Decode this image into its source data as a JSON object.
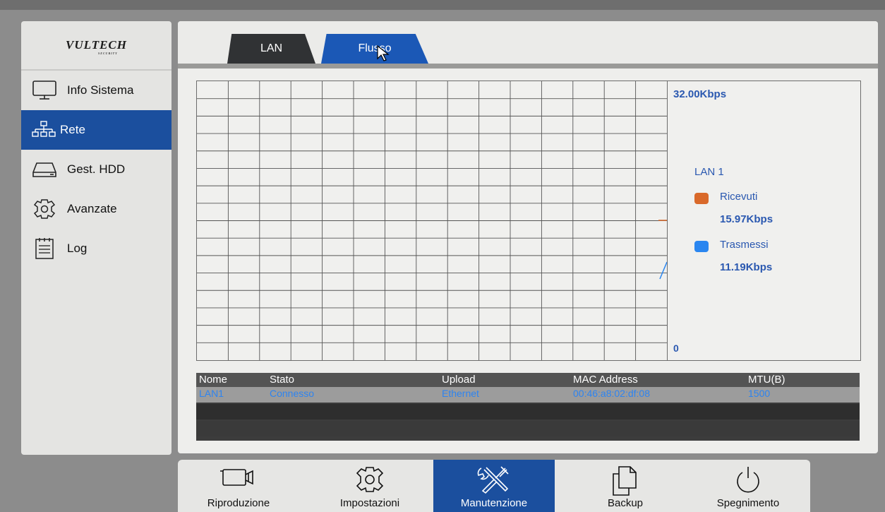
{
  "brand": {
    "logo_text": "VULTECH",
    "logo_sub": "SECURITY"
  },
  "sidebar": {
    "items": [
      {
        "label": "Info Sistema",
        "icon": "monitor-icon",
        "active": false
      },
      {
        "label": "Rete",
        "icon": "network-icon",
        "active": true
      },
      {
        "label": "Gest. HDD",
        "icon": "hdd-icon",
        "active": false
      },
      {
        "label": "Avanzate",
        "icon": "gear-icon",
        "active": false
      },
      {
        "label": "Log",
        "icon": "log-icon",
        "active": false
      }
    ]
  },
  "tabs": [
    {
      "label": "LAN",
      "active": false
    },
    {
      "label": "Flusso",
      "active": true
    }
  ],
  "graph": {
    "axis_max": "32.00Kbps",
    "axis_min": "0",
    "legend_title": "LAN 1",
    "received": {
      "label": "Ricevuti",
      "value": "15.97Kbps",
      "color": "#d9692a"
    },
    "transmitted": {
      "label": "Trasmessi",
      "value": "11.19Kbps",
      "color": "#2a86f0"
    }
  },
  "table": {
    "headers": [
      "Nome",
      "Stato",
      "Upload",
      "MAC Address",
      "MTU(B)"
    ],
    "rows": [
      [
        "LAN1",
        "Connesso",
        "Ethernet",
        "00:46:a8:02:df:08",
        "1500"
      ]
    ]
  },
  "bottom_nav": [
    {
      "label": "Riproduzione",
      "icon": "camera-icon",
      "active": false
    },
    {
      "label": "Impostazioni",
      "icon": "gear-icon",
      "active": false
    },
    {
      "label": "Manutenzione",
      "icon": "tools-icon",
      "active": true
    },
    {
      "label": "Backup",
      "icon": "copy-icon",
      "active": false
    },
    {
      "label": "Spegnimento",
      "icon": "power-icon",
      "active": false
    }
  ],
  "colors": {
    "accent": "#1b4f9e",
    "tab_active": "#1b58b6",
    "text_blue": "#2a58b0"
  }
}
